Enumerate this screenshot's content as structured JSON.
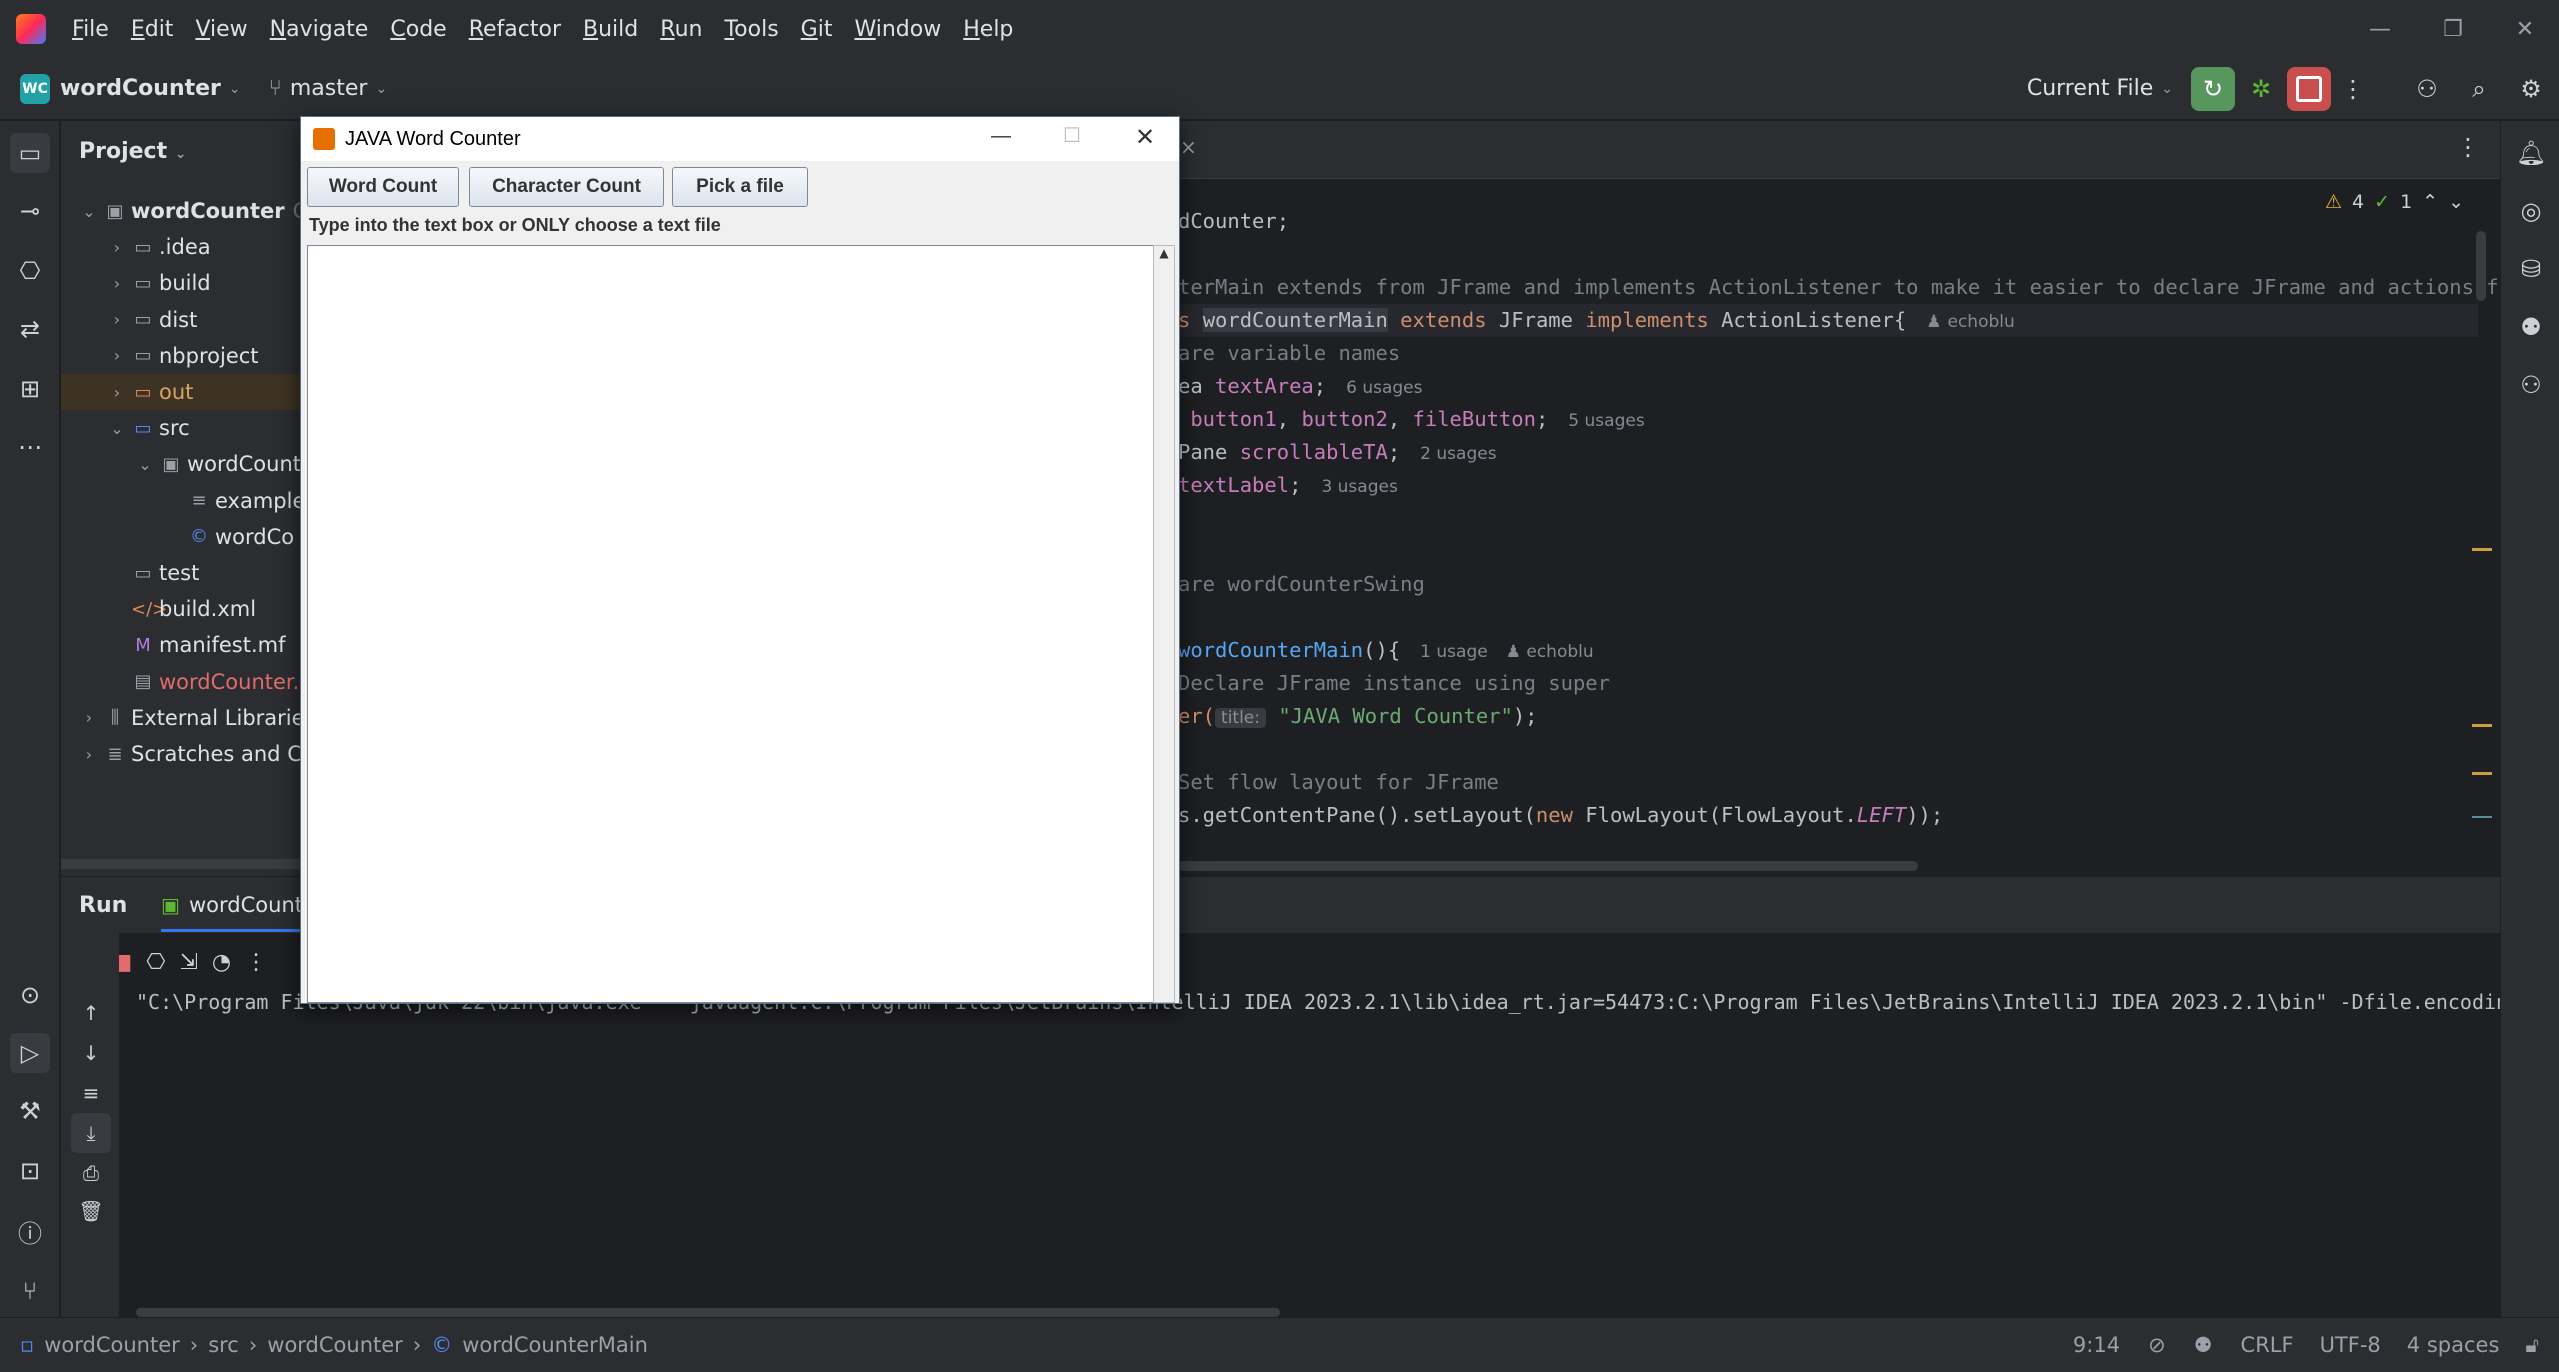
{
  "menu": [
    "File",
    "Edit",
    "View",
    "Navigate",
    "Code",
    "Refactor",
    "Build",
    "Run",
    "Tools",
    "Git",
    "Window",
    "Help"
  ],
  "toolbar": {
    "project": "wordCounter",
    "project_badge": "WC",
    "branch": "master",
    "run_config": "Current File"
  },
  "project_panel": {
    "title": "Project",
    "tree": [
      {
        "label": "wordCounter",
        "suffix": "C:",
        "depth": 0,
        "open": true,
        "kind": "module"
      },
      {
        "label": ".idea",
        "depth": 1,
        "kind": "folder"
      },
      {
        "label": "build",
        "depth": 1,
        "kind": "folder"
      },
      {
        "label": "dist",
        "depth": 1,
        "kind": "folder"
      },
      {
        "label": "nbproject",
        "depth": 1,
        "kind": "folder"
      },
      {
        "label": "out",
        "depth": 1,
        "kind": "folder-excluded"
      },
      {
        "label": "src",
        "depth": 1,
        "open": true,
        "kind": "folder-src"
      },
      {
        "label": "wordCount",
        "depth": 2,
        "open": true,
        "kind": "package"
      },
      {
        "label": "example",
        "depth": 3,
        "kind": "text"
      },
      {
        "label": "wordCo",
        "depth": 3,
        "kind": "class"
      },
      {
        "label": "test",
        "depth": 1,
        "kind": "folder"
      },
      {
        "label": "build.xml",
        "depth": 1,
        "kind": "xml"
      },
      {
        "label": "manifest.mf",
        "depth": 1,
        "kind": "mf"
      },
      {
        "label": "wordCounter.i",
        "depth": 1,
        "kind": "iml"
      },
      {
        "label": "External Libraries",
        "depth": 0,
        "kind": "lib"
      },
      {
        "label": "Scratches and Co",
        "depth": 0,
        "kind": "scratch"
      }
    ]
  },
  "editor": {
    "warnings": "4",
    "checks": "1",
    "lines": [
      {
        "segs": [
          [
            "dCounter;",
            ""
          ]
        ]
      },
      {
        "segs": []
      },
      {
        "segs": [
          [
            "terMain extends from JFrame and implements ActionListener to make it easier to declare JFrame and actions for",
            "cmt"
          ]
        ]
      },
      {
        "segs": [
          [
            "s ",
            "kw"
          ],
          [
            "wordCounterMain",
            "hl"
          ],
          [
            " extends ",
            "kw"
          ],
          [
            "JFrame ",
            ""
          ],
          [
            "implements ",
            "kw"
          ],
          [
            "ActionListener{",
            ""
          ]
        ],
        "hint": "echoblu",
        "hint_author": true
      },
      {
        "segs": [
          [
            "are variable names",
            "cmt"
          ]
        ]
      },
      {
        "segs": [
          [
            "ea ",
            ""
          ],
          [
            "textArea",
            "fld"
          ],
          [
            ";",
            ""
          ]
        ],
        "hint": "6 usages"
      },
      {
        "segs": [
          [
            " button1",
            "fld"
          ],
          [
            ", ",
            ""
          ],
          [
            "button2",
            "fld"
          ],
          [
            ", ",
            ""
          ],
          [
            "fileButton",
            "fld"
          ],
          [
            ";",
            ""
          ]
        ],
        "hint": "5 usages"
      },
      {
        "segs": [
          [
            "Pane ",
            ""
          ],
          [
            "scrollableTA",
            "fld"
          ],
          [
            ";",
            ""
          ]
        ],
        "hint": "2 usages"
      },
      {
        "segs": [
          [
            "textLabel",
            "fld"
          ],
          [
            ";",
            ""
          ]
        ],
        "hint": "3 usages"
      },
      {
        "segs": []
      },
      {
        "segs": []
      },
      {
        "segs": [
          [
            "are wordCounterSwing",
            "cmt"
          ]
        ]
      },
      {
        "segs": []
      },
      {
        "segs": [
          [
            "wordCounterMain",
            "fn"
          ],
          [
            "(){",
            ""
          ]
        ],
        "hint": "1 usage",
        "hint2": "echoblu"
      },
      {
        "segs": [
          [
            "Declare JFrame instance using super",
            "cmt"
          ]
        ]
      },
      {
        "segs": [
          [
            "er(",
            "kw"
          ],
          [
            "title:",
            "inlay"
          ],
          [
            " ",
            ""
          ],
          [
            "\"JAVA Word Counter\"",
            "str"
          ],
          [
            ");",
            ""
          ]
        ]
      },
      {
        "segs": []
      },
      {
        "segs": [
          [
            "Set flow layout for JFrame",
            "cmt"
          ]
        ]
      },
      {
        "segs": [
          [
            "s.getContentPane().setLayout(",
            ""
          ],
          [
            "new ",
            "kw"
          ],
          [
            "FlowLayout(FlowLayout.",
            ""
          ],
          [
            "LEFT",
            "it"
          ],
          [
            "));",
            ""
          ]
        ]
      }
    ]
  },
  "run_panel": {
    "tab_run": "Run",
    "tab_config": "wordCounte",
    "output": "\"C:\\Program Files\\Java\\jdk-22\\bin\\java.exe\" \"-javaagent:C:\\Program Files\\JetBrains\\IntelliJ IDEA 2023.2.1\\lib\\idea_rt.jar=54473:C:\\Program Files\\JetBrains\\IntelliJ IDEA 2023.2.1\\bin\" -Dfile.encodin"
  },
  "status_bar": {
    "breadcrumbs": [
      "wordCounter",
      "src",
      "wordCounter",
      "wordCounterMain"
    ],
    "position": "9:14",
    "line_ending": "CRLF",
    "encoding": "UTF-8",
    "indent": "4 spaces"
  },
  "swing_window": {
    "title": "JAVA Word Counter",
    "buttons": [
      "Word Count",
      "Character Count",
      "Pick a file"
    ],
    "label": "Type into the text box or ONLY choose a text file",
    "text_area": ""
  },
  "colors": {
    "accent": "#3574f0",
    "run_green": "#57965c",
    "stop_red": "#c94f4f",
    "swing_title_bg": "#ffffff"
  }
}
